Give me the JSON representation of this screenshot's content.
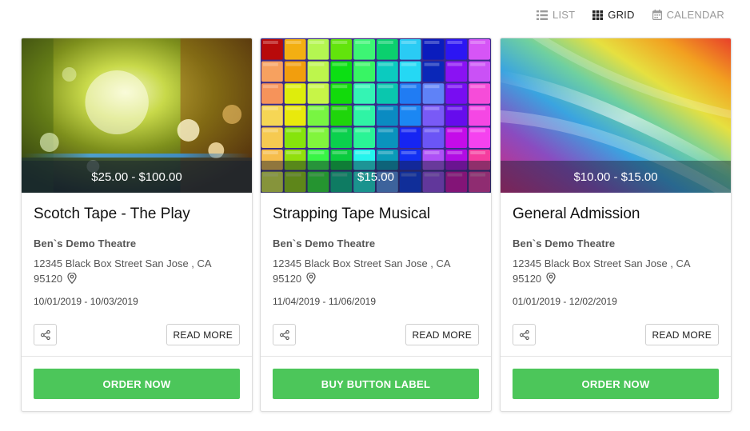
{
  "view_switch": {
    "list_label": "LIST",
    "grid_label": "GRID",
    "calendar_label": "CALENDAR",
    "active": "grid"
  },
  "colors": {
    "accent_green": "#4cc65a",
    "muted": "#9a9a9a"
  },
  "cards": [
    {
      "price": "$25.00 - $100.00",
      "title": "Scotch Tape - The Play",
      "venue": "Ben`s Demo Theatre",
      "address_line1": "12345 Black Box Street San Jose , CA",
      "address_line2": "95120",
      "dates": "10/01/2019 - 10/03/2019",
      "read_more": "READ MORE",
      "cta": "ORDER NOW",
      "image": "golden bokeh lights"
    },
    {
      "price": "$15.00",
      "title": "Strapping Tape Musical",
      "venue": "Ben`s Demo Theatre",
      "address_line1": "12345 Black Box Street San Jose , CA",
      "address_line2": "95120",
      "dates": "11/04/2019 - 11/06/2019",
      "read_more": "READ MORE",
      "cta": "BUY BUTTON LABEL",
      "image": "rainbow cubes"
    },
    {
      "price": "$10.00 - $15.00",
      "title": "General Admission",
      "venue": "Ben`s Demo Theatre",
      "address_line1": "12345 Black Box Street San Jose , CA",
      "address_line2": "95120",
      "dates": "01/01/2019 - 12/02/2019",
      "read_more": "READ MORE",
      "cta": "ORDER NOW",
      "image": "rainbow gradient swirl"
    }
  ]
}
